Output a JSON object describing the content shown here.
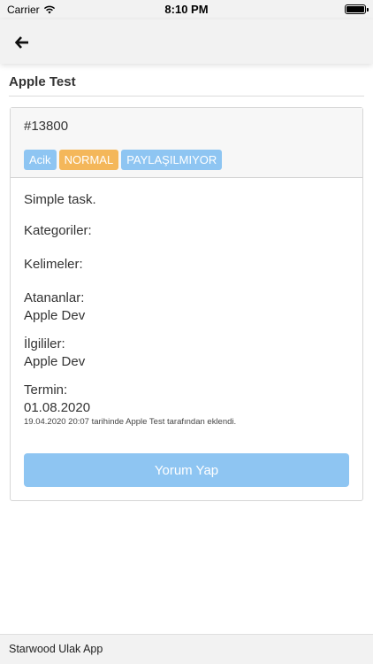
{
  "status_bar": {
    "carrier": "Carrier",
    "time": "8:10 PM"
  },
  "nav": {
    "back_icon": "arrow-left-icon"
  },
  "page": {
    "title": "Apple Test"
  },
  "task": {
    "id": "#13800",
    "badges": [
      {
        "label": "Acik",
        "color": "#8ec5f2"
      },
      {
        "label": "NORMAL",
        "color": "#f4b75a"
      },
      {
        "label": "PAYLAŞILMIYOR",
        "color": "#8ec5f2"
      }
    ],
    "description": "Simple task.",
    "categories_label": "Kategoriler:",
    "keywords_label": "Kelimeler:",
    "assignees_label": "Atananlar:",
    "assignees_value": "Apple Dev",
    "related_label": "İlgililer:",
    "related_value": "Apple Dev",
    "due_label": "Termin:",
    "due_value": "01.08.2020",
    "created_note": "19.04.2020 20:07 tarihinde Apple Test tarafından eklendi.",
    "comment_button": "Yorum Yap"
  },
  "footer": {
    "text": "Starwood Ulak App"
  }
}
